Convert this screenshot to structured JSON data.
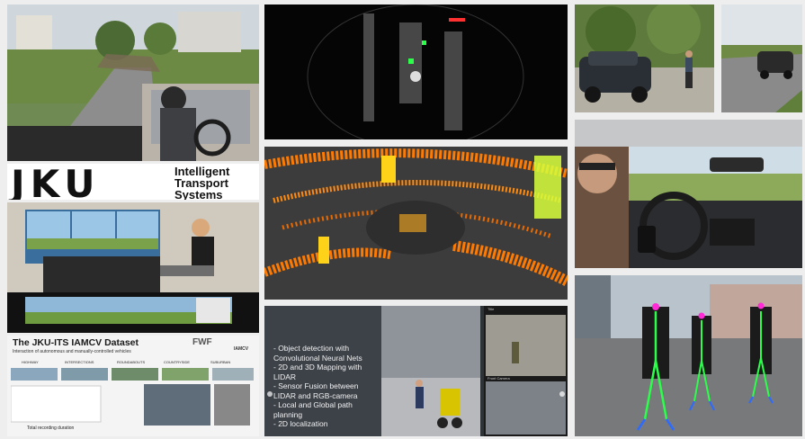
{
  "logo": {
    "letters": "JKU",
    "lines": [
      "Intelligent",
      "Transport",
      "Systems"
    ]
  },
  "poster": {
    "title": "The JKU-ITS IAMCV Dataset",
    "subtitle": "Interaction of autonomous and manually-controlled vehicles",
    "categories": [
      "HIGHWAY",
      "INTERSECTIONS",
      "ROUNDABOUTS",
      "COUNTRYSIDE",
      "SUBURBAN"
    ],
    "brand_fwf": "FWF",
    "brand_iamcv": "IAMCV",
    "footer": "Total recording duration"
  },
  "robot_panel": {
    "bullets": [
      "- Object detection with",
      "Convolutional Neural Nets",
      "- 2D and 3D Mapping with",
      "LIDAR",
      "- Sensor Fusion between",
      "LIDAR and RGB-camera",
      "- Local and Global path",
      "planning",
      "- 2D localization"
    ],
    "view_labels": [
      "Title",
      "Front Camera"
    ]
  },
  "colors": {
    "pointcloud_warm": "#ff7a00",
    "pointcloud_hot": "#ffd21a",
    "skeleton_green": "#2bff4a",
    "skeleton_blue": "#2d6bff",
    "skeleton_magenta": "#ff2bd6",
    "background": "#eeeeee"
  }
}
